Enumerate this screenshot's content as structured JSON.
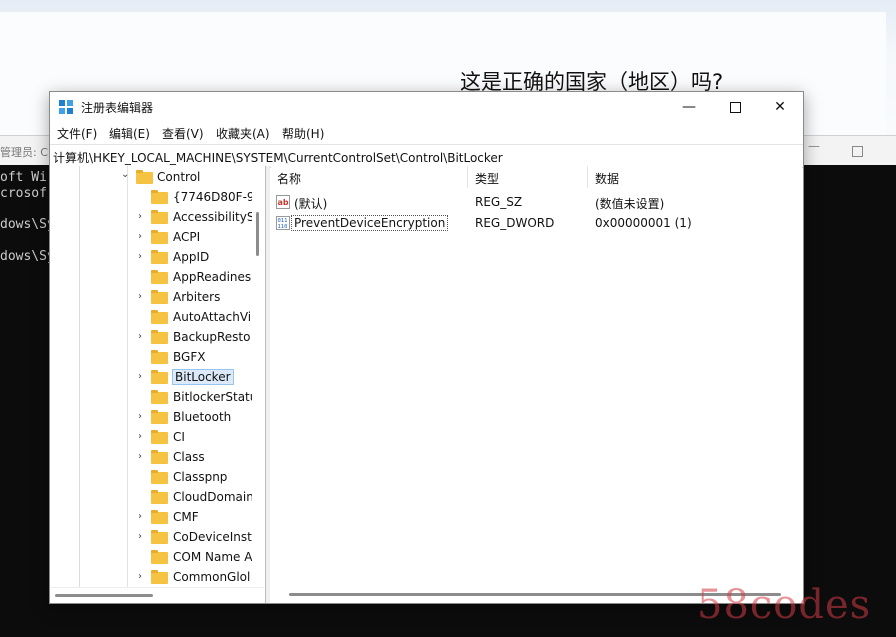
{
  "background": {
    "oobe_question": "这是正确的国家（地区）吗?",
    "console_title": "管理员: C:\\Wi",
    "console_lines": [
      "oft Wi",
      "crosof",
      "dows\\Sy",
      "dows\\Sy"
    ]
  },
  "watermark": "58codes",
  "window": {
    "title": "注册表编辑器",
    "minimize_symbol": "—",
    "close_symbol": "✕"
  },
  "menu": {
    "items": [
      "文件(F)",
      "编辑(E)",
      "查看(V)",
      "收藏夹(A)",
      "帮助(H)"
    ]
  },
  "address": {
    "path": "计算机\\HKEY_LOCAL_MACHINE\\SYSTEM\\CurrentControlSet\\Control\\BitLocker"
  },
  "tree": {
    "parent": "Control",
    "parent_chevron": "⌄",
    "child_chevron": "›",
    "children": [
      {
        "label": "{7746D80F-97",
        "expandable": false
      },
      {
        "label": "AccessibilityS",
        "expandable": true
      },
      {
        "label": "ACPI",
        "expandable": true
      },
      {
        "label": "AppID",
        "expandable": true
      },
      {
        "label": "AppReadines",
        "expandable": false
      },
      {
        "label": "Arbiters",
        "expandable": true
      },
      {
        "label": "AutoAttachVi",
        "expandable": false
      },
      {
        "label": "BackupResto",
        "expandable": true
      },
      {
        "label": "BGFX",
        "expandable": false
      },
      {
        "label": "BitLocker",
        "expandable": true,
        "selected": true
      },
      {
        "label": "BitlockerStatu",
        "expandable": false
      },
      {
        "label": "Bluetooth",
        "expandable": true
      },
      {
        "label": "CI",
        "expandable": true
      },
      {
        "label": "Class",
        "expandable": true
      },
      {
        "label": "Classpnp",
        "expandable": false
      },
      {
        "label": "CloudDomain",
        "expandable": false
      },
      {
        "label": "CMF",
        "expandable": true
      },
      {
        "label": "CoDeviceInst",
        "expandable": true
      },
      {
        "label": "COM Name A",
        "expandable": false
      },
      {
        "label": "CommonGlol",
        "expandable": true
      }
    ]
  },
  "list": {
    "columns": {
      "name": "名称",
      "type": "类型",
      "data": "数据"
    },
    "rows": [
      {
        "icon": "string-value-icon",
        "name": "(默认)",
        "type": "REG_SZ",
        "data": "(数值未设置)"
      },
      {
        "icon": "binary-value-icon",
        "name": "PreventDeviceEncryption",
        "type": "REG_DWORD",
        "data": "0x00000001 (1)"
      }
    ]
  },
  "colors": {
    "selection": "#dbe9f8",
    "folder": "#f5c242",
    "console_bg": "#0c0c0c",
    "watermark": "#d23c46"
  }
}
